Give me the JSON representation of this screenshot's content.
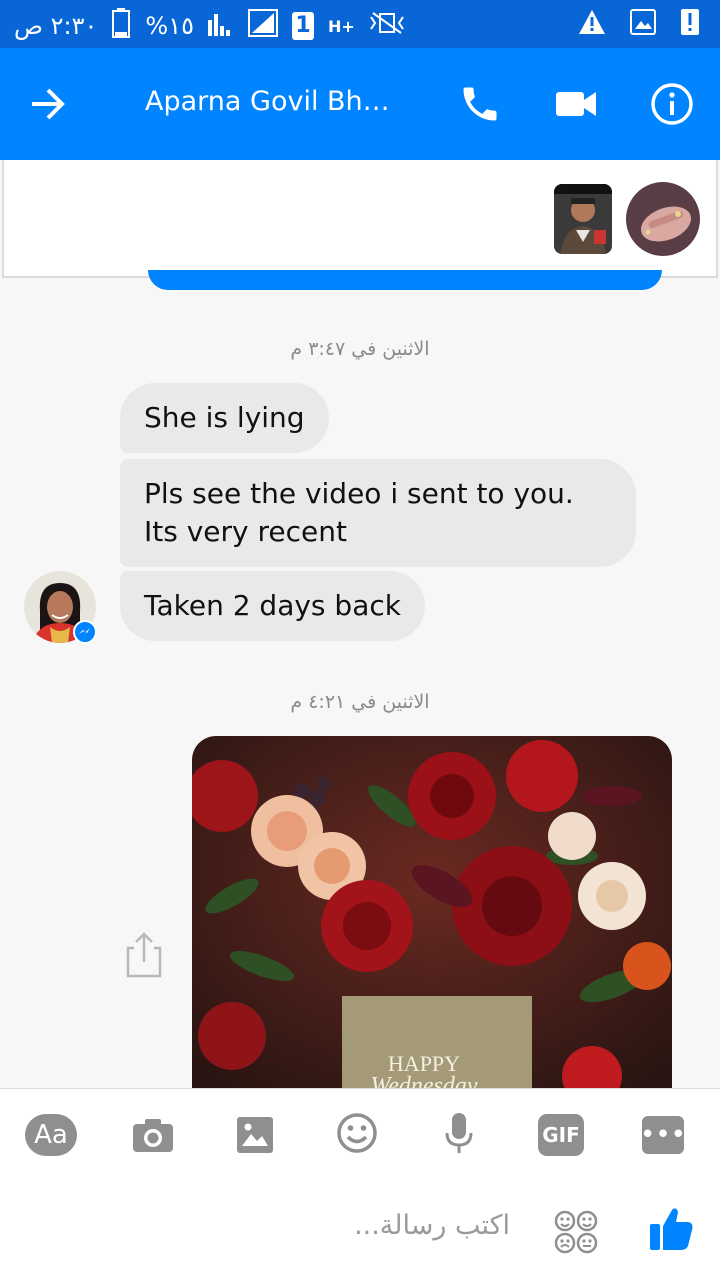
{
  "status": {
    "time": "٢:٣٠ ص",
    "battery": "%١٥",
    "sim": "1",
    "network": "H+"
  },
  "header": {
    "title": "Aparna Govil Bhas..."
  },
  "timestamps": [
    "الاثنين في ٣:٤٧ م",
    "الاثنين في ٤:٢١ م"
  ],
  "messages": [
    "She is lying",
    "Pls see the video i sent to you.\nIts very recent",
    "Taken 2 days back"
  ],
  "image_caption": "HAPPY Wednesday",
  "composer": {
    "aa_label": "Aa",
    "gif_label": "GIF",
    "more_label": "•••",
    "placeholder": "اكتب رسالة..."
  },
  "colors": {
    "status_bg": "#0866d6",
    "header_bg": "#0084ff",
    "bubble_bg": "#e9e9ea",
    "icon_gray": "#8f8f8f"
  }
}
